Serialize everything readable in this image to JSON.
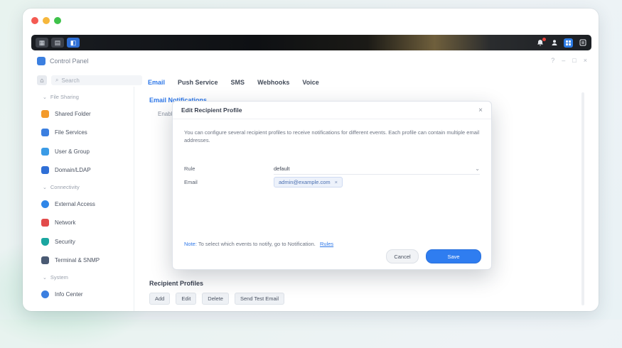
{
  "window": {
    "app_title": "Control Panel"
  },
  "taskbar": {
    "left_buttons": [
      "▦",
      "▤",
      "◧"
    ],
    "right_icons": [
      "bell-icon",
      "user-icon",
      "widgets-icon",
      "options-icon"
    ]
  },
  "sidebar": {
    "search_placeholder": "Search",
    "groups": [
      {
        "label": "File Sharing",
        "items": [
          {
            "label": "Shared Folder",
            "color": "#f39a2b"
          },
          {
            "label": "File Services",
            "color": "#3b7fe0"
          },
          {
            "label": "User & Group",
            "color": "#3b9be6"
          },
          {
            "label": "Domain/LDAP",
            "color": "#2f6fd6"
          }
        ]
      },
      {
        "label": "Connectivity",
        "items": [
          {
            "label": "External Access",
            "color": "#2f86e8"
          },
          {
            "label": "Network",
            "color": "#e24b4b"
          },
          {
            "label": "Security",
            "color": "#1aa6a0"
          },
          {
            "label": "Terminal & SNMP",
            "color": "#4a5a73"
          }
        ]
      },
      {
        "label": "System",
        "items": [
          {
            "label": "Info Center",
            "color": "#3b7fe0"
          }
        ]
      }
    ]
  },
  "main": {
    "tabs": [
      "Email",
      "Push Service",
      "SMS",
      "Webhooks",
      "Voice"
    ],
    "active_tab": 0,
    "section_title": "Email Notifications",
    "bg_line": "Enable email notifications",
    "section_recipient": "Recipient Profiles",
    "chips": [
      "Add",
      "Edit",
      "Delete",
      "Send Test Email"
    ]
  },
  "dialog": {
    "title": "Edit Recipient Profile",
    "close_icon": "×",
    "description": "You can configure several recipient profiles to receive notifications for different events. Each profile can contain multiple email addresses.",
    "rule_label": "Rule",
    "rule_value": "default",
    "email_label": "Email",
    "email_value": "admin@example.com",
    "note_label": "Note:",
    "note_text": "To select which events to notify, go to Notification.",
    "note_link": "Rules",
    "cancel_label": "Cancel",
    "save_label": "Save"
  }
}
